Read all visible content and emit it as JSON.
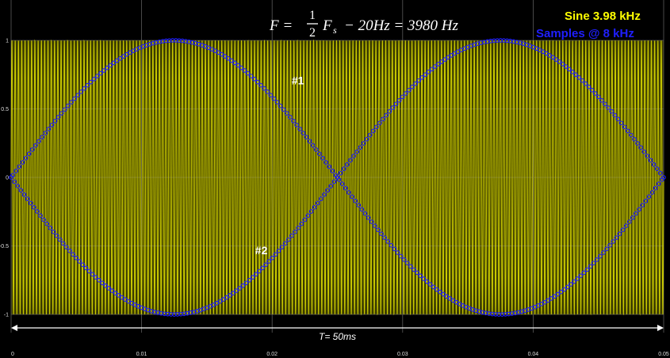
{
  "chart_data": {
    "type": "line",
    "formula": {
      "lhs": "F =",
      "frac_num": "1",
      "frac_den": "2",
      "rhs_var": "F",
      "rhs_sub": "s",
      "rhs_rest": "− 20Hz = 3980 Hz"
    },
    "legend": [
      {
        "label": "Sine 3.98 kHz",
        "color": "#ffff00"
      },
      {
        "label": "Samples @ 8 kHz",
        "color": "#1f1fff"
      }
    ],
    "xlim": [
      0,
      0.05
    ],
    "ylim": [
      -1,
      1
    ],
    "x_ticks": [
      "0",
      "0.01",
      "0.02",
      "0.03",
      "0.04",
      "0.05"
    ],
    "x_tick_values": [
      0,
      0.01,
      0.02,
      0.03,
      0.04,
      0.05
    ],
    "y_ticks": [
      "1",
      "0.5",
      "0",
      "-0.5",
      "-1"
    ],
    "y_tick_values": [
      1,
      0.5,
      0,
      -0.5,
      -1
    ],
    "signal_frequency_hz": 3980,
    "sample_rate_hz": 8000,
    "envelope_frequency_hz": 20,
    "annotations": [
      {
        "text": "#1",
        "x": 0.0215,
        "y": 0.68
      },
      {
        "text": "#2",
        "x": 0.0187,
        "y": -0.56
      }
    ],
    "period_label": "T= 50ms",
    "period_start": 0,
    "period_end": 0.05,
    "grid": true,
    "colors": {
      "background": "#000000",
      "plot_background": "#3a3a00",
      "sine": "#e6e600",
      "samples": "#1f1fff",
      "grid": "#5a5a5a"
    }
  }
}
